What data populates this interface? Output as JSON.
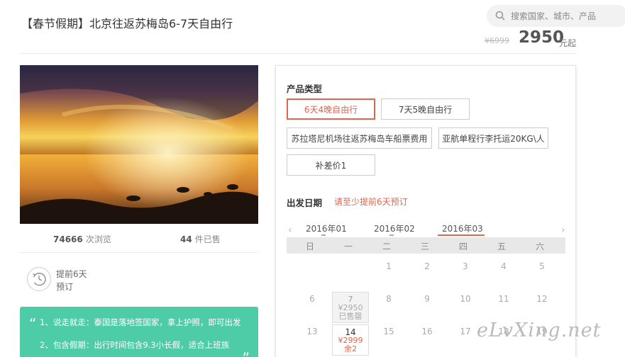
{
  "product": {
    "title": "【春节假期】北京往返苏梅岛6-7天自由行",
    "old_price": "¥6999",
    "price": "2950",
    "price_unit": "元起"
  },
  "search": {
    "placeholder": "搜索国家、城市、产品",
    "icon": "search-icon"
  },
  "stats": {
    "views_count": "74666",
    "views_label": "次浏览",
    "sold_count": "44",
    "sold_label": "件已售"
  },
  "booking_notice": {
    "line1": "提前6天",
    "line2": "预订",
    "icon": "clock-icon"
  },
  "highlights": {
    "line1": "1、说走就走：泰国是落地签国家，拿上护照，即可出发",
    "line2": "2、包含假期：出行时间包含9.3小长假，适合上班族"
  },
  "product_type": {
    "label": "产品类型",
    "options": [
      {
        "label": "6天4晚自由行",
        "selected": true
      },
      {
        "label": "7天5晚自由行",
        "selected": false
      },
      {
        "label": "苏拉塔尼机场往返苏梅岛车船票费用",
        "selected": false
      },
      {
        "label": "亚航单程行李托运20KG\\人",
        "selected": false
      },
      {
        "label": "补差价1",
        "selected": false
      }
    ]
  },
  "departure": {
    "label": "出发日期",
    "notice": "请至少提前6天预订",
    "months": [
      "2016年01",
      "2016年02",
      "2016年03"
    ],
    "selected_month": "2016年03",
    "weekdays": [
      "日",
      "一",
      "二",
      "三",
      "四",
      "五",
      "六"
    ],
    "days": {
      "d1": "1",
      "d2": "2",
      "d3": "3",
      "d4": "4",
      "d5": "5",
      "d6": "6",
      "d7": "7",
      "d8": "8",
      "d9": "9",
      "d10": "10",
      "d11": "11",
      "d12": "12",
      "d13": "13",
      "d14": "14",
      "d15": "15",
      "d16": "16",
      "d17": "17",
      "d18": "18",
      "d19": "19"
    },
    "day7_price": "¥2950",
    "day7_status": "已售罄",
    "day14_price": "¥2999",
    "day14_status": "余2"
  },
  "watermark": "eLvXing.net",
  "colors": {
    "accent": "#e0654f",
    "note_bg": "#4ecba7"
  }
}
